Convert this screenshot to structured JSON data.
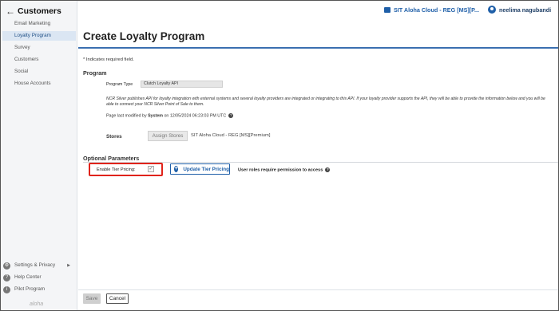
{
  "sidebar": {
    "title": "Customers",
    "items": [
      {
        "label": "Email Marketing"
      },
      {
        "label": "Loyalty Program"
      },
      {
        "label": "Survey"
      },
      {
        "label": "Customers"
      },
      {
        "label": "Social"
      },
      {
        "label": "House Accounts"
      }
    ],
    "active_item": "Loyalty Program",
    "bottom": {
      "settings": "Settings & Privacy",
      "help": "Help Center",
      "pilot": "Pilot Program"
    },
    "logo_text": "aloha"
  },
  "topbar": {
    "site_name": "SIT Aloha Cloud - REG [MS][P...",
    "user_name": "neelima nagubandi"
  },
  "page": {
    "title": "Create Loyalty Program",
    "required_note": "* Indicates required field.",
    "program_section": "Program",
    "program_type_label": "Program Type",
    "program_type_value": "Clutch Loyalty API",
    "description": "NCR Silver publishes API for loyalty integration with external systems and several loyalty providers are integrated or integrating to this API. If your loyalty provider supports the API, they will be able to provide the information below and you will be able to connect your NCR Silver Point of Sale to them.",
    "modified_prefix": "Page last modified by ",
    "modified_by": "System",
    "modified_suffix": " on 12/05/2024 06:23:03 PM UTC",
    "stores_label": "Stores",
    "assign_stores_button": "Assign Stores",
    "stores_value": "SIT Aloha Cloud - REG [MS][Premium]",
    "optional_section": "Optional Parameters",
    "tier_label": "Enable Tier Pricing:",
    "tier_checked": true,
    "update_tier_button": "Update Tier Pricing",
    "permission_note": "User roles require permission to access",
    "save_button": "Save",
    "cancel_button": "Cancel"
  },
  "colors": {
    "accent": "#1f5fa8",
    "highlight_box": "#e0231a",
    "active_item_bg": "#dbe6f3"
  }
}
